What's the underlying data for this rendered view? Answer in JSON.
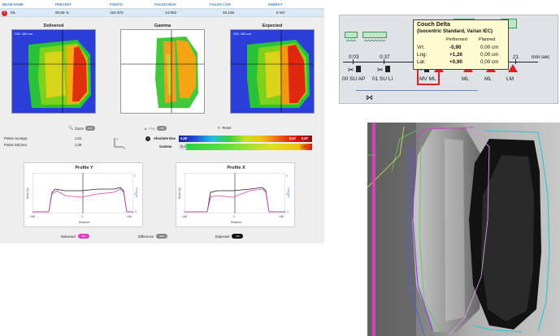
{
  "table": {
    "headers": [
      "BEAM NAME",
      "PERCENT",
      "POINTS",
      "FAILED HIGH",
      "FAILED LOW",
      "ENERGY"
    ],
    "row": {
      "name": "ML",
      "percent": "60,56 %",
      "points": "154.970",
      "failed_high": "14.962",
      "failed_low": "46.155",
      "energy": "6 MV"
    }
  },
  "maps": {
    "delivered": {
      "title": "Delivered",
      "sid": "SID: 160 cm"
    },
    "gamma": {
      "title": "Gamma"
    },
    "expected": {
      "title": "Expected",
      "sid": "SID: 160 cm"
    }
  },
  "controls": {
    "zoom_label": "Zoom",
    "zoom_state": "OFF",
    "play_label": "Play",
    "play_state": "OFF",
    "reset_label": "Reset"
  },
  "stats": {
    "points_average_label": "Points Average:",
    "points_average_value": "1,04",
    "points_std_label": "Points Std Dev:",
    "points_std_value": "1,08"
  },
  "colorbars": {
    "absolute_label": "Absolute Dos",
    "absolute_min": "0,00",
    "absolute_max": "0,67",
    "absolute_max2": "0,67",
    "gamma_label": "Gamma",
    "gamma_min": "N.A",
    "gamma_max": "1,01"
  },
  "profiles": {
    "y": {
      "title": "Profile Y",
      "xlabel": "Distance",
      "ylabel": "Dose Gy",
      "ylabel_right": "Gamma",
      "tick_left": "-168",
      "tick_zero": "0",
      "tick_right": "168",
      "right_ticks": [
        "5",
        "0",
        "-5"
      ]
    },
    "x": {
      "title": "Profile X",
      "xlabel": "Distance",
      "ylabel": "Dose Gy",
      "ylabel_right": "Gamma",
      "tick_left": "-168",
      "tick_zero": "0",
      "tick_right": "168",
      "right_ticks": [
        "5",
        "0",
        "-5"
      ]
    }
  },
  "legend": {
    "delivered_label": "Delivered",
    "delivered_state": "ON",
    "difference_label": "Difference",
    "difference_state": "OFF",
    "expected_label": "Expected",
    "expected_state": "ON"
  },
  "timeline": {
    "times": [
      "0:03",
      "0:37",
      "21"
    ],
    "unit": "min:sec",
    "beams": [
      "00 SU AP",
      "01 SU LI",
      "MV ML",
      "ML",
      "ML",
      "LM"
    ]
  },
  "tooltip": {
    "title": "Couch Delta",
    "subtitle": "(Isocentric Standard, Varian IEC)",
    "col_performed": "Performed",
    "col_planned": "Planned",
    "rows": [
      {
        "label": "Vrt:",
        "performed": "-0,90",
        "planned": "0,00 cm"
      },
      {
        "label": "Lng:",
        "performed": "+1,26",
        "planned": "0,00 cm"
      },
      {
        "label": "Lat:",
        "performed": "+0,90",
        "planned": "0,00 cm"
      }
    ]
  },
  "colors": {
    "accent_blue": "#4a86c8",
    "alert_red": "#dd2222",
    "toggle_pink": "#e040c0",
    "highlight_red": "#e02020"
  }
}
